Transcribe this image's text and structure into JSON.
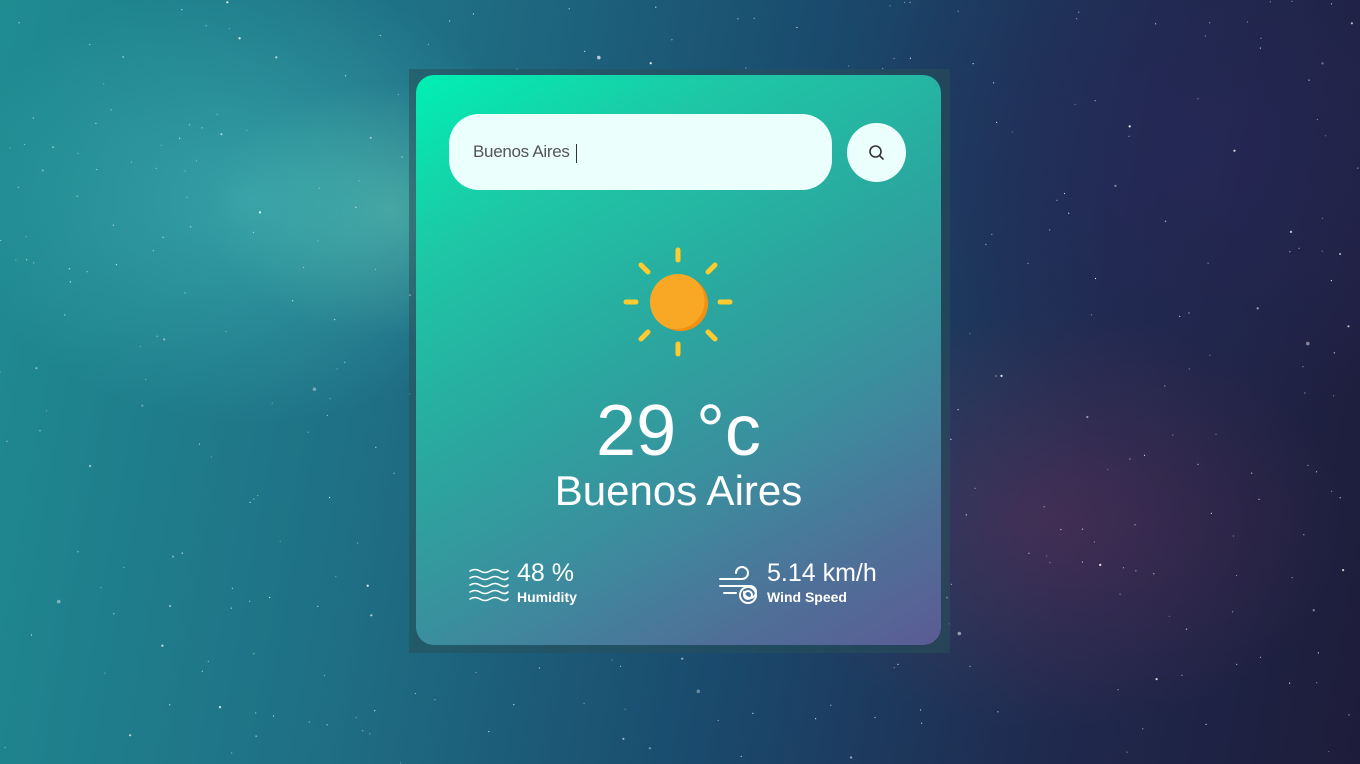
{
  "search": {
    "value": "Buenos Aires",
    "icon": "search-icon"
  },
  "weather": {
    "icon": "sun-icon",
    "temperature": "29 °c",
    "city": "Buenos Aires"
  },
  "humidity": {
    "icon": "humidity-icon",
    "value": "48 %",
    "label": "Humidity"
  },
  "wind": {
    "icon": "wind-icon",
    "value": "5.14 km/h",
    "label": "Wind Speed"
  },
  "colors": {
    "card_gradient_start": "#00f0b4",
    "card_gradient_end": "#5b5b94",
    "sun_core": "#f9a825",
    "sun_rays": "#ffcb2e",
    "input_bg": "#ebfffc"
  }
}
